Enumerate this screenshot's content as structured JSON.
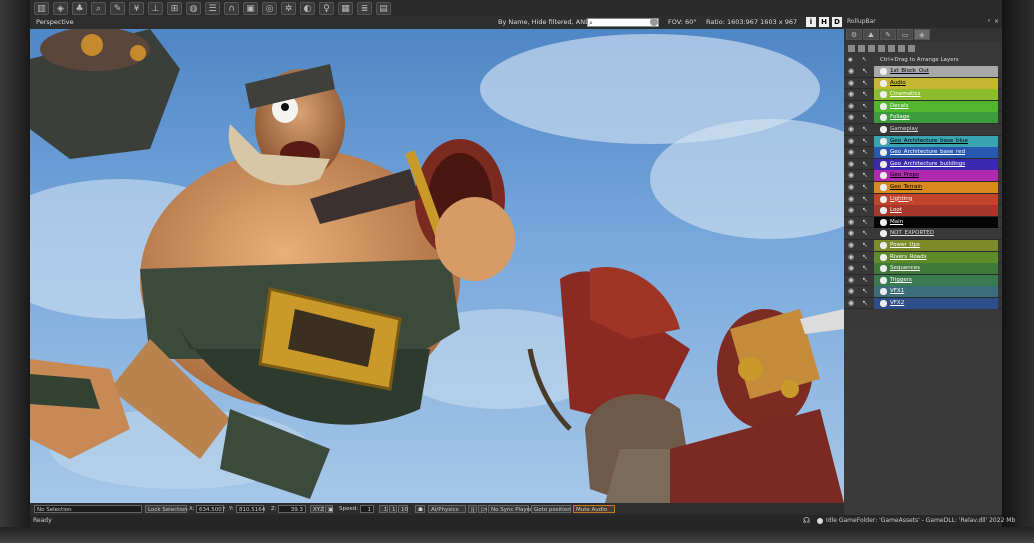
{
  "toolbar": {
    "icons": [
      "book-icon",
      "layers-icon",
      "tree-icon",
      "magnifier-icon",
      "wand-icon",
      "palm-icon",
      "lamp-icon",
      "hierarchy-icon",
      "globe-icon",
      "list-icon",
      "headphones-icon",
      "image-icon",
      "sphere-icon",
      "sun-icon",
      "shield-icon",
      "bulb-icon",
      "grid-icon",
      "panel-icon",
      "save-icon"
    ]
  },
  "viewport": {
    "title": "Perspective",
    "filter_text": "By Name, Hide filtered, AND",
    "fov_label": "FOV:",
    "fov_value": "60°",
    "ratio_label": "Ratio: 1603:967",
    "resolution": "1603 x 967",
    "buttons": [
      "i",
      "H",
      "D"
    ]
  },
  "status": {
    "selection": "No Selection",
    "lock_selection": "Lock Selection",
    "x_label": "X:",
    "x_value": "634.5007",
    "y_label": "Y:",
    "y_value": "810.5164",
    "z_label": "Z:",
    "z_value": "39.3",
    "xyz": "XYZ",
    "speed_label": "Speed:",
    "speed_value": "1",
    "speed_opts": [
      ".1",
      "1",
      "10"
    ],
    "ai_physics": "AI/Physics",
    "no_sync": "No Sync Player",
    "goto": "Goto position",
    "mute": "Mute Audio",
    "ready": "Ready",
    "info": "Idle   GameFolder: 'GameAssets' - GameDLL: 'Relav.dll'   2022 Mb"
  },
  "rollup": {
    "title": "RollupBar",
    "ctrl_hint": "Ctrl+Drag to Arrange Layers",
    "layers": [
      {
        "name": "1st_Block_Out",
        "color": "#a9a9a9",
        "text": "#000"
      },
      {
        "name": "Audio",
        "color": "#c4b62e",
        "text": "#000"
      },
      {
        "name": "Cinematics",
        "color": "#8bbd2c",
        "text": "#fff"
      },
      {
        "name": "Decals",
        "color": "#51b52e",
        "text": "#fff"
      },
      {
        "name": "Foliage",
        "color": "#3a9c3a",
        "text": "#fff"
      },
      {
        "name": "Gameplay",
        "color": "#383838",
        "text": "#ddd"
      },
      {
        "name": "Geo_Architecture_base_blue",
        "color": "#3aa5b0",
        "text": "#000"
      },
      {
        "name": "Geo_Architecture_base_red",
        "color": "#2859b0",
        "text": "#fff"
      },
      {
        "name": "Geo_Architecture_buildings",
        "color": "#3b2ab0",
        "text": "#fff"
      },
      {
        "name": "Geo_Props",
        "color": "#b02ab0",
        "text": "#000"
      },
      {
        "name": "Geo_Terrain",
        "color": "#d88a1d",
        "text": "#000"
      },
      {
        "name": "Lighting",
        "color": "#c0432a",
        "text": "#fff"
      },
      {
        "name": "Loot",
        "color": "#a6362a",
        "text": "#fff"
      },
      {
        "name": "Main",
        "color": "#050505",
        "text": "#fff"
      },
      {
        "name": "NOT_EXPORTED",
        "color": "#383838",
        "text": "#ddd"
      },
      {
        "name": "Power_Ups",
        "color": "#7d8a2a",
        "text": "#fff"
      },
      {
        "name": "Rivers_Roads",
        "color": "#5f8a2a",
        "text": "#fff"
      },
      {
        "name": "Sequences",
        "color": "#3f7a3a",
        "text": "#fff"
      },
      {
        "name": "Triggers",
        "color": "#3b7a4f",
        "text": "#fff"
      },
      {
        "name": "VFX1",
        "color": "#3b6e7a",
        "text": "#fff"
      },
      {
        "name": "VFX2",
        "color": "#2d4e8a",
        "text": "#fff"
      }
    ]
  }
}
